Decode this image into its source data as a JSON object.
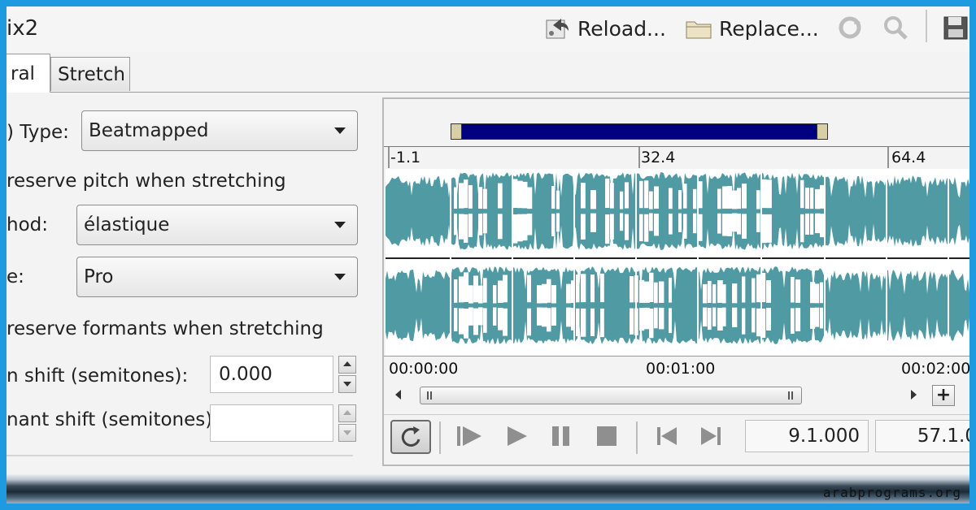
{
  "window": {
    "title": "ix2"
  },
  "toolbar": {
    "reload_label": "Reload...",
    "replace_label": "Replace..."
  },
  "tabs": [
    {
      "label": "ral",
      "active": true
    },
    {
      "label": "Stretch",
      "active": false
    }
  ],
  "general": {
    "type_label": ") Type:",
    "type_value": "Beatmapped",
    "preserve_pitch_label": "reserve pitch when stretching",
    "method_label": "hod:",
    "method_value": "élastique",
    "mode_label": "e:",
    "mode_value": "Pro",
    "preserve_formants_label": "reserve formants when stretching",
    "pitch_shift_label": "n shift (semitones):",
    "pitch_shift_value": "0.000",
    "formant_shift_label": "nant shift (semitones):",
    "formant_shift_value": ""
  },
  "waveform": {
    "ruler_labels": [
      "-1.1",
      "32.4",
      "64.4"
    ],
    "time_labels": [
      "00:00:00",
      "00:01:00",
      "00:02:00"
    ],
    "wave_color": "#4f9aa3",
    "loop_color": "#000080"
  },
  "transport": {
    "position_value": "9.1.000",
    "length_value": "57.1.0"
  },
  "watermark": "arabprograms.org"
}
